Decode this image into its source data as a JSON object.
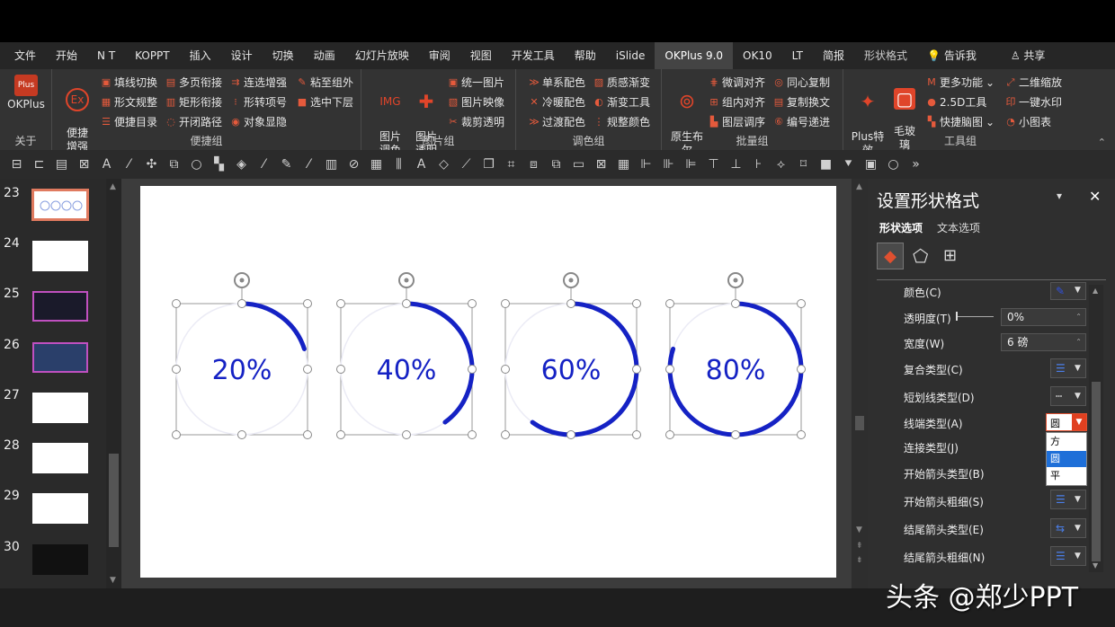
{
  "menu_tabs": [
    "文件",
    "开始",
    "N T",
    "KOPPT",
    "插入",
    "设计",
    "切换",
    "动画",
    "幻灯片放映",
    "审阅",
    "视图",
    "开发工具",
    "帮助",
    "iSlide",
    "OKPlus 9.0",
    "OK10",
    "LT",
    "简报",
    "形状格式"
  ],
  "active_tab": "OKPlus 9.0",
  "tell_me": "告诉我",
  "share": "共享",
  "ribbon": {
    "okplus_label": "OKPlus",
    "about_label": "关于",
    "bianjie": {
      "big_label": "便捷\n增强",
      "items": [
        "填线切换",
        "多页衔接",
        "连选增强",
        "粘至组外",
        "形文规整",
        "矩形衔接",
        "形转项号",
        "选中下层",
        "便捷目录",
        "开闭路径",
        "对象显隐"
      ],
      "group_label": "便捷组"
    },
    "picture": {
      "big1": "图片\n调色",
      "big2": "图片\n透明",
      "items": [
        "统一图片",
        "图片映像",
        "裁剪透明"
      ],
      "group_label": "图片组"
    },
    "color": {
      "items": [
        "单系配色",
        "质感渐变",
        "冷暖配色",
        "渐变工具",
        "过渡配色",
        "规整颜色"
      ],
      "group_label": "调色组"
    },
    "batch": {
      "big_label": "原生布\n尔",
      "items": [
        "微调对齐",
        "同心复制",
        "组内对齐",
        "复制换文",
        "图层调序",
        "编号递进"
      ],
      "group_label": "批量组"
    },
    "tools": {
      "big1": "Plus特\n效",
      "big2": "毛玻\n璃",
      "items": [
        "更多功能",
        "二维缩放",
        "2.5D工具",
        "一键水印",
        "快捷脑图",
        "小图表"
      ],
      "group_label": "工具组"
    }
  },
  "slide_numbers": [
    "23",
    "24",
    "25",
    "26",
    "27",
    "28",
    "29",
    "30"
  ],
  "chart_data": {
    "type": "progress-rings",
    "values": [
      20,
      40,
      60,
      80
    ],
    "labels": [
      "20%",
      "40%",
      "60%",
      "80%"
    ],
    "color": "#1522c4",
    "track_color": "#ebebf5"
  },
  "panel": {
    "title": "设置形状格式",
    "tab_shape": "形状选项",
    "tab_text": "文本选项",
    "rows": {
      "color": "颜色(C)",
      "transparency": "透明度(T)",
      "transparency_value": "0%",
      "width": "宽度(W)",
      "width_value": "6 磅",
      "compound": "复合类型(C)",
      "dash": "短划线类型(D)",
      "cap": "线端类型(A)",
      "cap_value": "圆",
      "join": "连接类型(J)",
      "begin_arrow": "开始箭头类型(B)",
      "begin_size": "开始箭头粗细(S)",
      "end_arrow": "结尾箭头类型(E)",
      "end_size": "结尾箭头粗细(N)"
    },
    "cap_options": [
      "方",
      "圆",
      "平"
    ],
    "cap_selected": "圆"
  },
  "watermark": "头条 @郑少PPT"
}
